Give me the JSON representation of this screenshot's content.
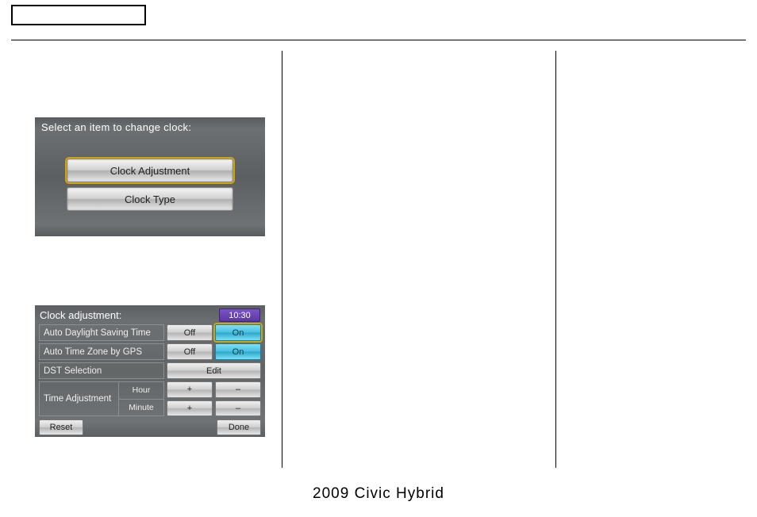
{
  "footer": "2009  Civic  Hybrid",
  "screen1": {
    "title": "Select an item to change clock:",
    "buttons": [
      {
        "label": "Clock Adjustment",
        "selected": true
      },
      {
        "label": "Clock Type",
        "selected": false
      }
    ]
  },
  "screen2": {
    "title": "Clock adjustment:",
    "clock": "10:30",
    "rows": {
      "adst": {
        "label": "Auto Daylight Saving Time",
        "off": "Off",
        "on": "On"
      },
      "atz": {
        "label": "Auto Time Zone by GPS",
        "off": "Off",
        "on": "On"
      },
      "dst": {
        "label": "DST Selection",
        "edit": "Edit"
      },
      "ta": {
        "label": "Time Adjustment",
        "hour": "Hour",
        "minute": "Minute",
        "plus": "+",
        "minus": "–"
      }
    },
    "reset": "Reset",
    "done": "Done"
  }
}
